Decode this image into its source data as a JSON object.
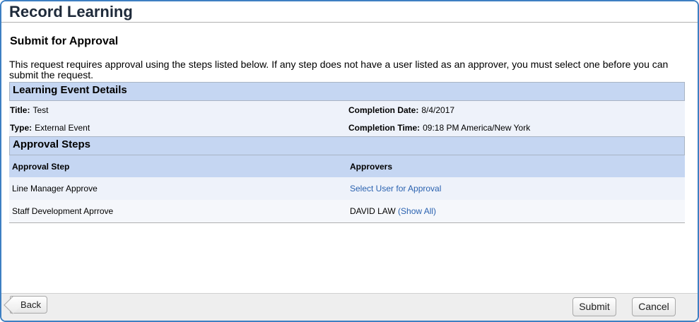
{
  "window": {
    "title": "Record Learning"
  },
  "page": {
    "subtitle": "Submit for Approval",
    "intro": "This request requires approval using the steps listed below. If any step does not have a user listed as an approver, you must select one before you can submit the request."
  },
  "learning_event": {
    "header": "Learning Event Details",
    "title_label": "Title:",
    "title_value": "Test",
    "type_label": "Type:",
    "type_value": "External Event",
    "completion_date_label": "Completion Date:",
    "completion_date_value": "8/4/2017",
    "completion_time_label": "Completion Time:",
    "completion_time_value": "09:18 PM America/New York"
  },
  "approval_steps": {
    "header": "Approval Steps",
    "columns": [
      "Approval Step",
      "Approvers"
    ],
    "rows": [
      {
        "step": "Line Manager Approve",
        "approver_link": "Select User for Approval"
      },
      {
        "step": "Staff Development Aprrove",
        "approver": "DAVID LAW",
        "approver_link": "(Show All)"
      }
    ]
  },
  "footer": {
    "back_label": "Back",
    "submit_label": "Submit",
    "cancel_label": "Cancel"
  },
  "colors": {
    "frame_border": "#3d7fc2",
    "section_header_bg": "#c5d6f2",
    "row_alt_bg": "#eef2fa",
    "link": "#2a62b0"
  }
}
